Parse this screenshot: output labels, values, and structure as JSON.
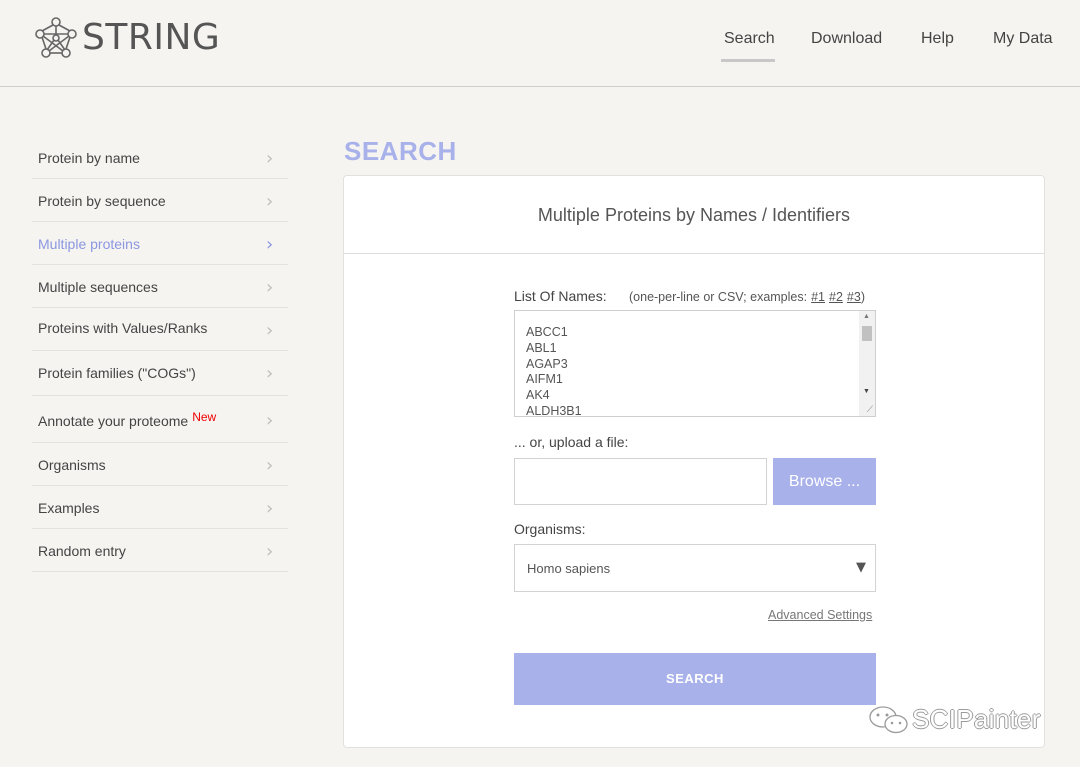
{
  "app": {
    "logo_text": "STRING"
  },
  "nav": {
    "items": [
      "Search",
      "Download",
      "Help",
      "My Data"
    ],
    "active": "Search"
  },
  "sidebar": {
    "items": [
      {
        "label": "Protein by name"
      },
      {
        "label": "Protein by sequence"
      },
      {
        "label": "Multiple proteins",
        "active": true
      },
      {
        "label": "Multiple sequences"
      },
      {
        "label": "Proteins with Values/Ranks"
      },
      {
        "label": "Protein families (\"COGs\")"
      },
      {
        "label": "Annotate your proteome",
        "badge": "New"
      },
      {
        "label": "Organisms"
      },
      {
        "label": "Examples"
      },
      {
        "label": "Random entry"
      }
    ],
    "chevron": "›",
    "badge_color": "#e00000"
  },
  "main": {
    "heading": "SEARCH",
    "panel_title": "Multiple Proteins by Names / Identifiers",
    "names_label": "List Of Names:",
    "names_hint_prefix": "(one-per-line or CSV; examples:",
    "examples": [
      "#1",
      "#2",
      "#3"
    ],
    "names_hint_suffix": ")",
    "names_list": [
      "ABCC1",
      "ABL1",
      "AGAP3",
      "AIFM1",
      "AK4",
      "ALDH3B1"
    ],
    "upload_label": "... or, upload a file:",
    "browse_label": "Browse ...",
    "organisms_label": "Organisms:",
    "organism_value": "Homo sapiens",
    "advanced_label": "Advanced Settings",
    "search_button": "SEARCH"
  },
  "watermark": {
    "text": "SCIPainter"
  },
  "colors": {
    "accent": "#a8b1ea",
    "active_link": "#8c97e0",
    "background": "#f5f4f1"
  }
}
